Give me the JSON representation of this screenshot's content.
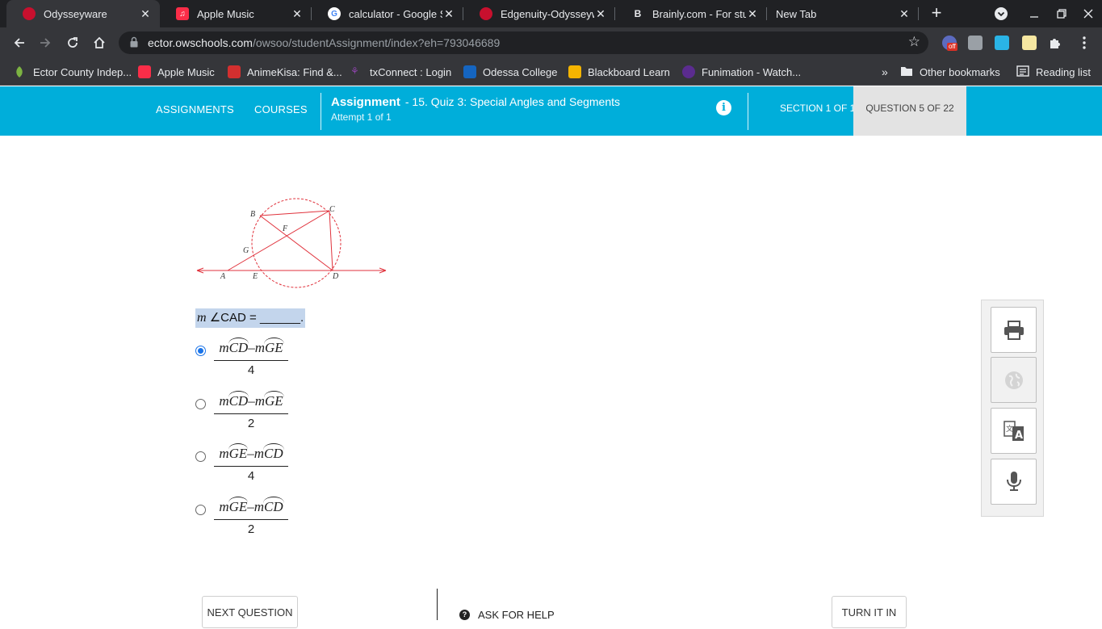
{
  "browser": {
    "tabs": [
      {
        "title": "Odysseyware",
        "active": true,
        "favicon_color": "#c8102e"
      },
      {
        "title": "Apple Music",
        "active": false,
        "favicon_color": "#fa2d48"
      },
      {
        "title": "calculator - Google Se",
        "active": false,
        "favicon_color": "#4285f4"
      },
      {
        "title": "Edgenuity-Odysseywa",
        "active": false,
        "favicon_color": "#c8102e"
      },
      {
        "title": "Brainly.com - For stud",
        "active": false,
        "favicon_color": "#202124"
      },
      {
        "title": "New Tab",
        "active": false,
        "favicon_color": ""
      }
    ],
    "close_glyph": "✕",
    "new_tab_glyph": "+",
    "url_host": "ector.owschools.com",
    "url_path": "/owsoo/studentAssignment/index?eh=793046689",
    "bookmarks": [
      {
        "label": "Ector County Indep...",
        "icon_color": "#7cb342"
      },
      {
        "label": "Apple Music",
        "icon_color": "#fa2d48"
      },
      {
        "label": "AnimeKisa: Find &...",
        "icon_color": "#d32f2f"
      },
      {
        "label": "txConnect : Login",
        "icon_color": "#8e44ad"
      },
      {
        "label": "Odessa College",
        "icon_color": "#1565c0"
      },
      {
        "label": "Blackboard Learn",
        "icon_color": "#f4b400"
      },
      {
        "label": "Funimation - Watch...",
        "icon_color": "#5b2c8f"
      },
      {
        "label": "Other bookmarks",
        "icon_color": "#e8eaed"
      },
      {
        "label": "Reading list",
        "icon_color": "#e8eaed"
      }
    ],
    "bookmarks_overflow": "»",
    "extension_badge": "off"
  },
  "header": {
    "nav": [
      "ASSIGNMENTS",
      "COURSES"
    ],
    "assignment_label": "Assignment",
    "assignment_title": "- 15. Quiz 3: Special Angles and Segments",
    "attempt": "Attempt 1 of 1",
    "section": "SECTION 1 OF 1",
    "question": "QUESTION 5 OF 22",
    "colors": {
      "bar": "#00aeda",
      "question_tab": "#e3e3e3"
    }
  },
  "figure": {
    "point_labels": [
      "A",
      "B",
      "C",
      "D",
      "E",
      "F",
      "G"
    ],
    "line_color": "#e0323c"
  },
  "question": {
    "prompt_var": "m",
    "prompt_rest": "∠CAD = ______.",
    "choices": [
      {
        "arc1": "CD",
        "arc2": "GE",
        "op": "–",
        "denominator": "4",
        "selected": true
      },
      {
        "arc1": "CD",
        "arc2": "GE",
        "op": "–",
        "denominator": "2",
        "selected": false
      },
      {
        "arc1": "GE",
        "arc2": "CD",
        "op": "–",
        "denominator": "4",
        "selected": false
      },
      {
        "arc1": "GE",
        "arc2": "CD",
        "op": "–",
        "denominator": "2",
        "selected": false
      }
    ]
  },
  "tools": [
    {
      "icon": "printer-icon",
      "enabled": true
    },
    {
      "icon": "globe-icon",
      "enabled": false
    },
    {
      "icon": "translate-icon",
      "enabled": true
    },
    {
      "icon": "microphone-icon",
      "enabled": true
    }
  ],
  "footer": {
    "next": "NEXT QUESTION",
    "help": "ASK FOR HELP",
    "turn_in": "TURN IT IN"
  }
}
